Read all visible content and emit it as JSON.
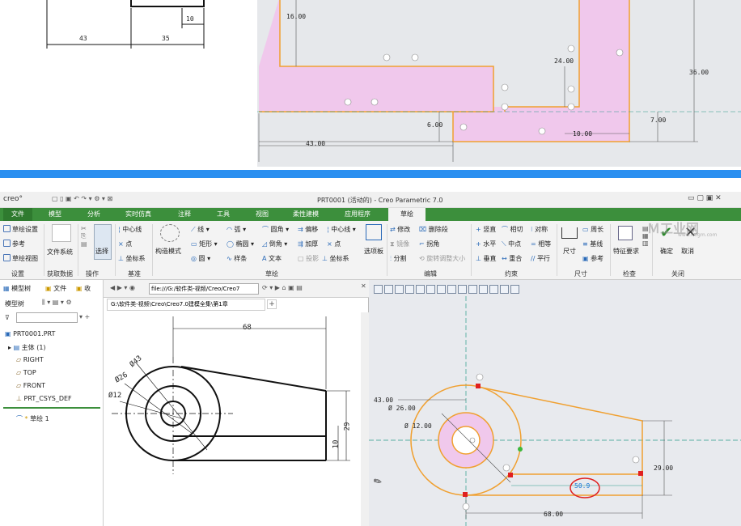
{
  "top_drawing": {
    "dims": [
      "43",
      "35",
      "10"
    ]
  },
  "top_sketch": {
    "dims": [
      "16.00",
      "24.00",
      "36.00",
      "6.00",
      "7.00",
      "43.00",
      "10.00"
    ]
  },
  "app": {
    "logo": "creo°",
    "title": "PRT0001 (活动的) - Creo Parametric 7.0",
    "tabs": [
      "文件",
      "模型",
      "分析",
      "实时仿真",
      "注释",
      "工具",
      "视图",
      "柔性建模",
      "应用程序",
      "草绘"
    ],
    "active_tab": "草绘"
  },
  "ribbon": {
    "setup": {
      "items": [
        "草绘设置",
        "参考",
        "草绘视图"
      ],
      "label": "设置"
    },
    "data": {
      "item": "文件系统",
      "label": "获取数据"
    },
    "ops": {
      "item": "选择",
      "label": "操作"
    },
    "datum": {
      "items": [
        "中心线",
        "点",
        "坐标系"
      ],
      "label": "基准"
    },
    "construct": "构造模式",
    "sketch": {
      "items": [
        "线",
        "弧",
        "圆角",
        "偏移",
        "中心线",
        "矩形",
        "椭圆",
        "倒角",
        "加厚",
        "点",
        "圆",
        "样条",
        "文本",
        "投影",
        "坐标系"
      ],
      "label": "草绘"
    },
    "palette": "选项板",
    "edit": {
      "items": [
        "修改",
        "删除段",
        "镜像",
        "拐角",
        "分割",
        "旋转调整大小"
      ],
      "label": "编辑"
    },
    "constrain": {
      "items": [
        "竖直",
        "相切",
        "对称",
        "水平",
        "中点",
        "相等",
        "垂直",
        "重合",
        "平行"
      ],
      "label": "约束"
    },
    "dimension": {
      "items": [
        "尺寸",
        "周长",
        "基线",
        "参考"
      ],
      "label": "尺寸"
    },
    "inspect": {
      "item": "特征要求",
      "label": "检查"
    },
    "close": {
      "items": [
        "确定",
        "取消"
      ],
      "label": "关闭"
    },
    "watermark": "Ｍ工业网",
    "watermark_url": "www.mfgm.com"
  },
  "left_panel": {
    "tabs": [
      "模型树",
      "文件",
      "收"
    ],
    "tree_label": "模型树",
    "items": [
      "PRT0001.PRT",
      "主体 (1)",
      "RIGHT",
      "TOP",
      "FRONT",
      "PRT_CSYS_DEF",
      "草绘 1"
    ]
  },
  "browser": {
    "url": "file:///G:/软件类-视频/Creo/Creo7",
    "tab": "G:\\软件类-视频\\Creo\\Creo7.0建模全集\\第1章"
  },
  "drawing": {
    "dims": [
      "68",
      "Ø43",
      "Ø26",
      "Ø12",
      "29",
      "10"
    ]
  },
  "sketch": {
    "dims": [
      "43.00",
      "Ø 26.00",
      "Ø 12.00",
      "29.00",
      "68.00",
      "50.9"
    ]
  },
  "colors": {
    "ribbon_green": "#3c8f3c",
    "sketch_orange": "#f0a030",
    "fill_pink": "#f0c8ec",
    "highlight": "#e02020",
    "blue_bar": "#2a8ff0"
  }
}
